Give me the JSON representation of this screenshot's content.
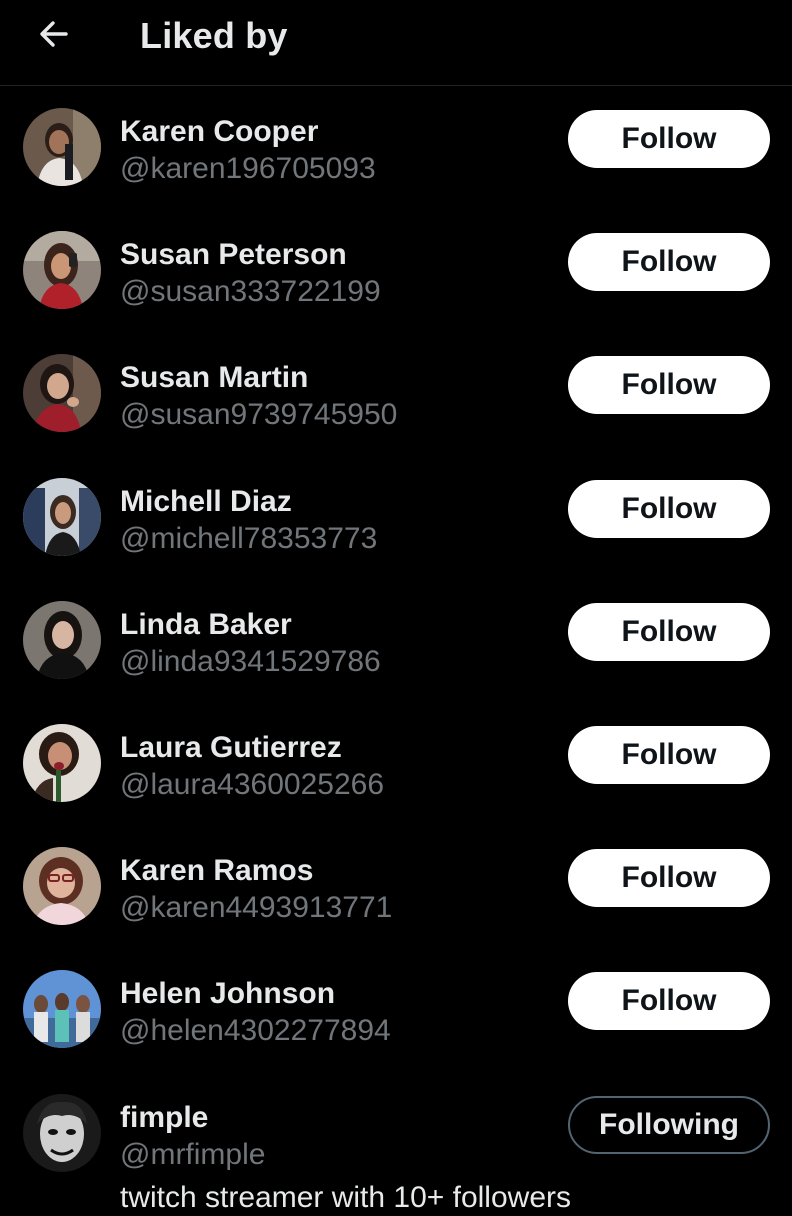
{
  "header": {
    "title": "Liked by",
    "back_icon": "arrow-left-icon"
  },
  "colors": {
    "background": "#000000",
    "primary_text": "#e7e9ea",
    "secondary_text": "#71767b",
    "follow_button_bg": "#ffffff",
    "follow_button_text": "#0f1419",
    "following_border": "#536471"
  },
  "users": [
    {
      "name": "Karen Cooper",
      "handle": "@karen196705093",
      "button": "Follow"
    },
    {
      "name": "Susan Peterson",
      "handle": "@susan333722199",
      "button": "Follow"
    },
    {
      "name": "Susan Martin",
      "handle": "@susan9739745950",
      "button": "Follow"
    },
    {
      "name": "Michell Diaz",
      "handle": "@michell78353773",
      "button": "Follow"
    },
    {
      "name": "Linda Baker",
      "handle": "@linda9341529786",
      "button": "Follow"
    },
    {
      "name": "Laura Gutierrez",
      "handle": "@laura4360025266",
      "button": "Follow"
    },
    {
      "name": "Karen Ramos",
      "handle": "@karen4493913771",
      "button": "Follow"
    },
    {
      "name": "Helen Johnson",
      "handle": "@helen4302277894",
      "button": "Follow"
    },
    {
      "name": "fimple",
      "handle": "@mrfimple",
      "button": "Following",
      "bio": "twitch streamer with 10+ followers"
    }
  ]
}
